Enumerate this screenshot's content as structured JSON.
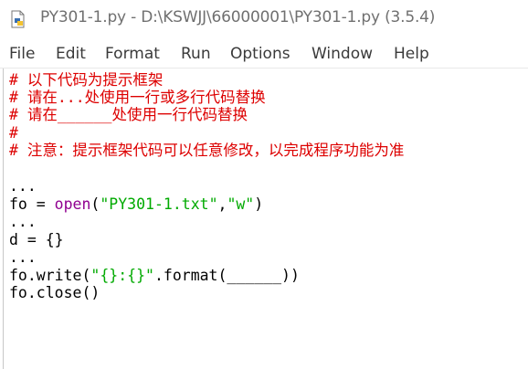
{
  "window": {
    "title": "PY301-1.py - D:\\KSWJJ\\66000001\\PY301-1.py (3.5.4)",
    "icon": "python-file-icon"
  },
  "menubar": {
    "items": [
      "File",
      "Edit",
      "Format",
      "Run",
      "Options",
      "Window",
      "Help"
    ]
  },
  "editor": {
    "lines": [
      {
        "kind": "comment",
        "text": "# 以下代码为提示框架"
      },
      {
        "kind": "comment",
        "text": "# 请在...处使用一行或多行代码替换"
      },
      {
        "kind": "comment",
        "text": "# 请在______处使用一行代码替换"
      },
      {
        "kind": "comment",
        "text": "#"
      },
      {
        "kind": "comment",
        "text": "# 注意：提示框架代码可以任意修改，以完成程序功能为准"
      },
      {
        "kind": "blank",
        "text": ""
      },
      {
        "kind": "code",
        "text": "..."
      },
      {
        "kind": "open",
        "pre": "fo = ",
        "builtin": "open",
        "paren_open": "(",
        "str1": "\"PY301-1.txt\"",
        "comma": ",",
        "str2": "\"w\"",
        "paren_close": ")"
      },
      {
        "kind": "code",
        "text": "..."
      },
      {
        "kind": "code",
        "text": "d = {}"
      },
      {
        "kind": "code",
        "text": "..."
      },
      {
        "kind": "write",
        "pre": "fo.write(",
        "str": "\"{}:{}\"",
        "post": ".format(______))"
      },
      {
        "kind": "code",
        "text": "fo.close()"
      }
    ]
  },
  "colors": {
    "comment": "#dd0000",
    "string": "#00aa00",
    "builtin": "#900090",
    "text": "#000000"
  }
}
